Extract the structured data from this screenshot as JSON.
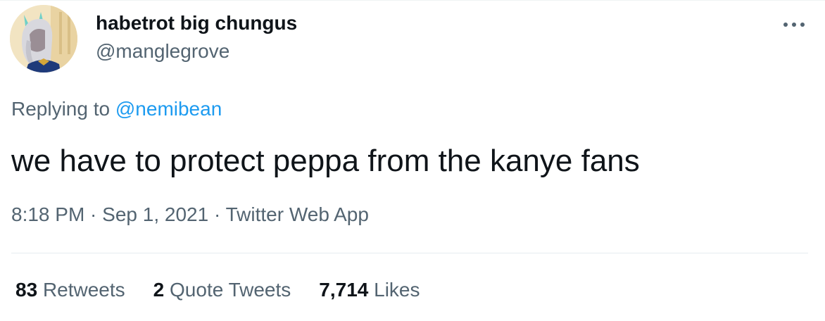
{
  "user": {
    "display_name": "habetrot big chungus",
    "handle": "@manglegrove"
  },
  "menu": {
    "icon": "more-horizontal-icon",
    "label": "•••"
  },
  "reply": {
    "prefix": "Replying to",
    "mention": "@nemibean"
  },
  "tweet": {
    "text": "we have to protect peppa from the kanye fans"
  },
  "meta": {
    "time": "8:18 PM",
    "separator": " · ",
    "date": "Sep 1, 2021",
    "source": "Twitter Web App"
  },
  "stats": {
    "retweets_count": "83",
    "retweets_label": "Retweets",
    "quotes_count": "2",
    "quotes_label": "Quote Tweets",
    "likes_count": "7,714",
    "likes_label": "Likes"
  },
  "colors": {
    "text_primary": "#0f1419",
    "text_secondary": "#536471",
    "link": "#1d9bf0",
    "divider": "#e6ecf0"
  }
}
